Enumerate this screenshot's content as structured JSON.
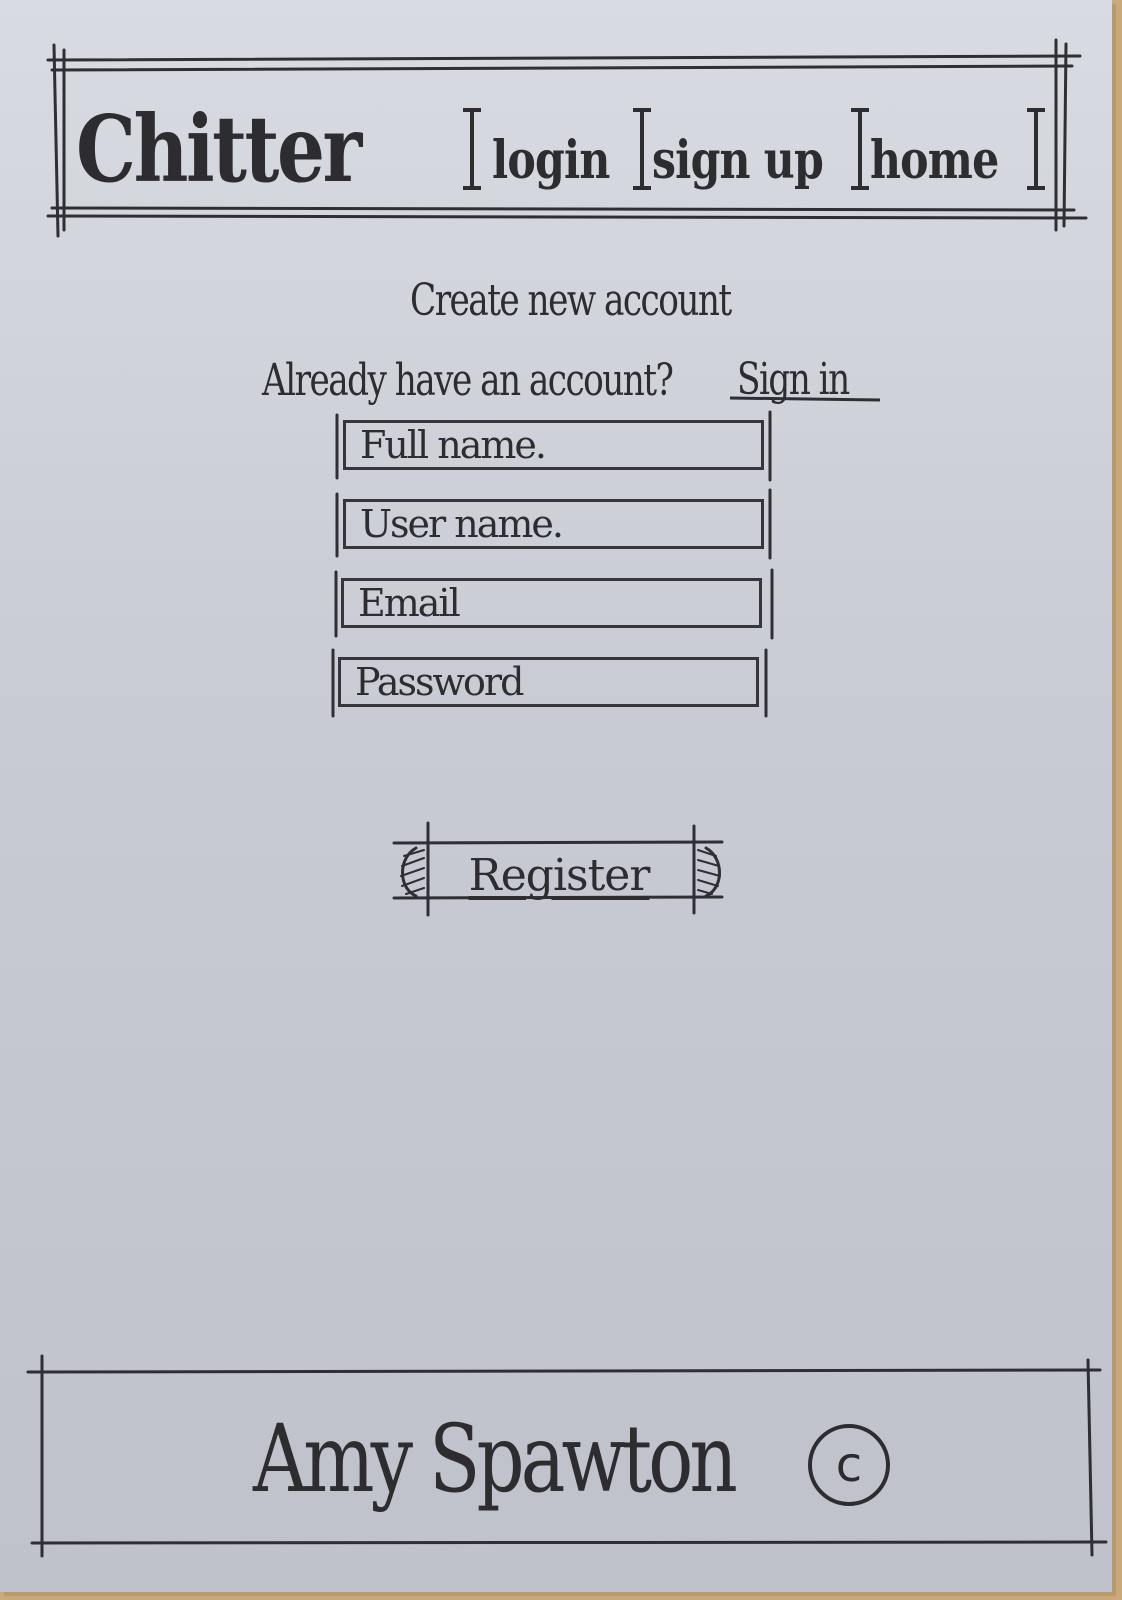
{
  "header": {
    "logo": "Chitter",
    "nav": [
      {
        "label": "login"
      },
      {
        "label": "sign up"
      },
      {
        "label": "home"
      }
    ]
  },
  "form": {
    "title": "Create new account",
    "signin_prompt": "Already have an account?",
    "signin_link": "Sign in",
    "fields": {
      "full_name": {
        "placeholder": "Full name."
      },
      "user_name": {
        "placeholder": "User name."
      },
      "email": {
        "placeholder": "Email"
      },
      "password": {
        "placeholder": "Password"
      }
    },
    "register_label": "Register"
  },
  "footer": {
    "author": "Amy Spawton",
    "copyright_symbol": "c"
  }
}
